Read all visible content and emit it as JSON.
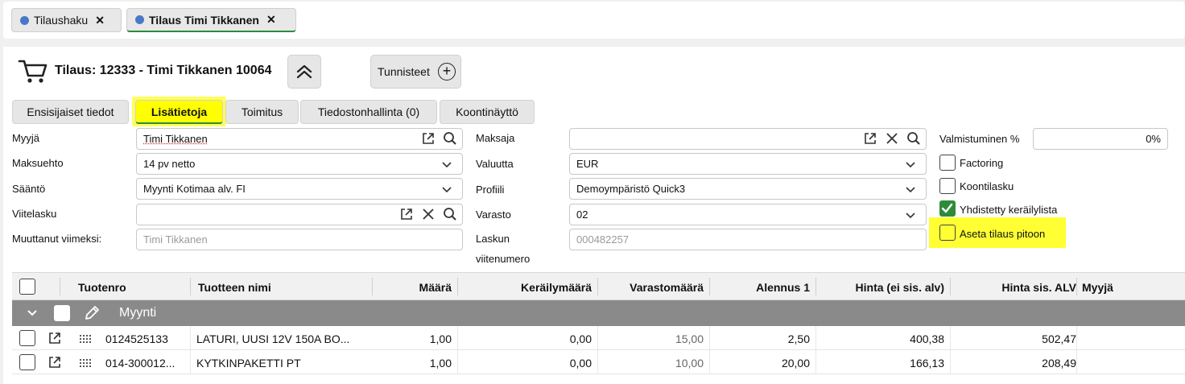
{
  "open_tabs": [
    {
      "label": "Tilaushaku",
      "close": "✕"
    },
    {
      "label": "Tilaus Timi Tikkanen",
      "close": "✕"
    }
  ],
  "header": {
    "title": "Tilaus: 12333 - Timi Tikkanen 10064",
    "tags_label": "Tunnisteet"
  },
  "tabs": [
    {
      "label": "Ensisijaiset tiedot"
    },
    {
      "label": "Lisätietoja"
    },
    {
      "label": "Toimitus"
    },
    {
      "label": "Tiedostonhallinta (0)"
    },
    {
      "label": "Koontinäyttö"
    }
  ],
  "form": {
    "seller_label": "Myyjä",
    "seller_value": "Timi Tikkanen",
    "payment_term_label": "Maksuehto",
    "payment_term_value": "14 pv netto",
    "rule_label": "Sääntö",
    "rule_value": "Myynti Kotimaa alv. FI",
    "ref_invoice_label": "Viitelasku",
    "ref_invoice_value": "",
    "modified_by_label": "Muuttanut viimeksi:",
    "modified_by_value": "Timi Tikkanen",
    "payer_label": "Maksaja",
    "payer_value": "",
    "currency_label": "Valuutta",
    "currency_value": "EUR",
    "profile_label": "Profiili",
    "profile_value": "Demoympäristö Quick3",
    "warehouse_label": "Varasto",
    "warehouse_value": "02",
    "invoice_ref_label_1": "Laskun",
    "invoice_ref_label_2": "viitenumero",
    "invoice_ref_value": "000482257",
    "completion_label": "Valmistuminen %",
    "completion_value": "0%",
    "factoring_label": "Factoring",
    "factoring_checked": false,
    "combined_invoice_label": "Koontilasku",
    "combined_invoice_checked": false,
    "combined_picklist_label": "Yhdistetty keräilylista",
    "combined_picklist_checked": true,
    "hold_order_label": "Aseta tilaus pitoon",
    "hold_order_checked": false
  },
  "grid": {
    "columns": [
      "Tuotenro",
      "Tuotteen nimi",
      "Määrä",
      "Keräilymäärä",
      "Varastomäärä",
      "Alennus 1",
      "Hinta (ei sis. alv)",
      "Hinta sis. ALV",
      "Myyjä"
    ],
    "group_label": "Myynti",
    "rows": [
      {
        "product_no": "0124525133",
        "name": "LATURI, UUSI 12V 150A BO...",
        "qty": "1,00",
        "pick_qty": "0,00",
        "stock_qty": "15,00",
        "discount": "2,50",
        "price_ex": "400,38",
        "price_inc": "502,47",
        "seller": ""
      },
      {
        "product_no": "014-300012...",
        "name": "KYTKINPAKETTI PT",
        "qty": "1,00",
        "pick_qty": "0,00",
        "stock_qty": "10,00",
        "discount": "20,00",
        "price_ex": "166,13",
        "price_inc": "208,49",
        "seller": ""
      }
    ]
  },
  "colors": {
    "accent_green": "#2e8b3a",
    "highlight_yellow": "#ffff00",
    "tab_dot_blue": "#4a78c8",
    "group_row_gray": "#8a8a8a"
  }
}
